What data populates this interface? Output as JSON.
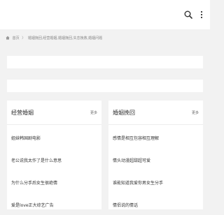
{
  "header": {
    "search_icon": "search-icon",
    "menu_icon": "menu-icon"
  },
  "breadcrumb": {
    "home_label": "首页",
    "path": "婚姻挽回,经营婚姻,婚姻挽回,失恋挽救,婚姻问题"
  },
  "cards": [
    {
      "title": "经营婚姻",
      "more_label": "更多",
      "items": [
        "姐妹韩国剧电影",
        "老公说我太作了是什么意思",
        "为什么分手后女生很绝情",
        "爱是love正大综艺广告"
      ]
    },
    {
      "title": "婚姻挽回",
      "more_label": "更多",
      "items": [
        "感情是相互包容相互理解",
        "情头动漫超甜超可爱",
        "谁能知道我爱你男女生分手",
        "情侣说的情话"
      ]
    }
  ]
}
